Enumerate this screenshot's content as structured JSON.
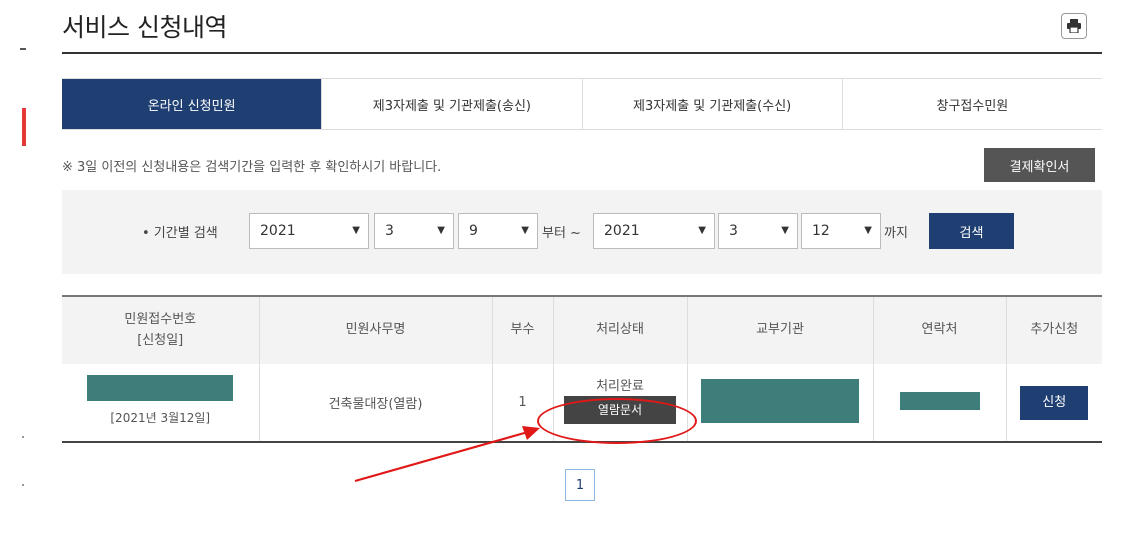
{
  "header": {
    "title": "서비스 신청내역"
  },
  "tabs": [
    {
      "label": "온라인 신청민원"
    },
    {
      "label": "제3자제출 및 기관제출(송신)"
    },
    {
      "label": "제3자제출 및 기관제출(수신)"
    },
    {
      "label": "창구접수민원"
    }
  ],
  "notice": "※ 3일 이전의 신청내용은 검색기간을 입력한 후 확인하시기 바랍니다.",
  "confirm_button": "결제확인서",
  "search": {
    "label": "• 기간별 검색",
    "from": {
      "year": "2021",
      "month": "3",
      "day": "9"
    },
    "from_suffix": "부터 ~",
    "to": {
      "year": "2021",
      "month": "3",
      "day": "12"
    },
    "to_suffix": "까지",
    "button": "검색"
  },
  "table": {
    "headers": {
      "receipt_no": "민원접수번호",
      "receipt_date": "[신청일]",
      "service_name": "민원사무명",
      "copies": "부수",
      "status": "처리상태",
      "issuer": "교부기관",
      "contact": "연락처",
      "additional": "추가신청"
    },
    "rows": [
      {
        "date": "[2021년 3월12일]",
        "service_name": "건축물대장(열람)",
        "copies": "1",
        "status": "처리완료",
        "open_doc_button": "열람문서",
        "apply_button": "신청"
      }
    ]
  },
  "pagination": {
    "current_page": "1"
  },
  "colors": {
    "primary": "#1f3f73",
    "redaction": "#3e7e7a",
    "annotation": "#e01818"
  },
  "icons": {
    "print": "printer-icon"
  }
}
